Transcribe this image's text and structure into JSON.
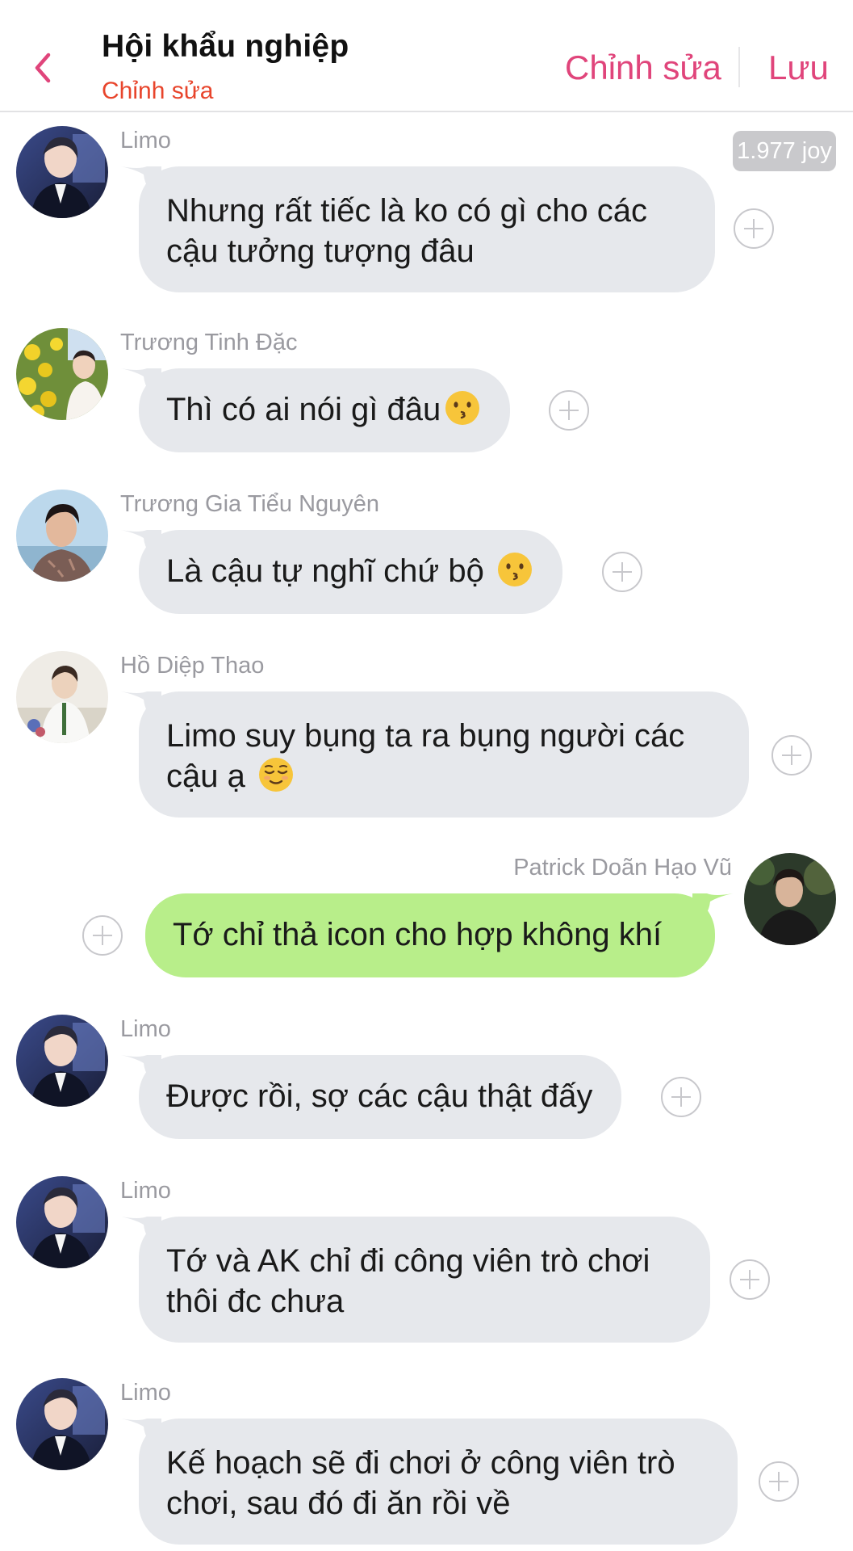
{
  "header": {
    "title": "Hội khẩu nghiệp",
    "subtitle": "Chỉnh sửa",
    "edit_label": "Chỉnh sửa",
    "save_label": "Lưu"
  },
  "joy_badge": "1.977 joy",
  "messages": [
    {
      "sender": "Limo",
      "text": "Nhưng rất tiếc là ko có gì cho các cậu tưởng tượng đâu",
      "direction": "incoming"
    },
    {
      "sender": "Trương Tinh Đặc",
      "text": "Thì có ai nói gì đâu",
      "emoji": "kissing-face",
      "direction": "incoming"
    },
    {
      "sender": "Trương Gia Tiểu Nguyên",
      "text": "Là cậu tự nghĩ chứ bộ ",
      "emoji": "kissing-face",
      "direction": "incoming"
    },
    {
      "sender": "Hồ Diệp Thao",
      "text": "Limo suy bụng ta ra bụng người các cậu ạ ",
      "emoji": "relieved-face",
      "direction": "incoming"
    },
    {
      "sender": "Patrick Doãn Hạo Vũ",
      "text": "Tớ chỉ thả icon cho hợp không khí",
      "direction": "outgoing"
    },
    {
      "sender": "Limo",
      "text": "Được rồi, sợ các cậu thật đấy",
      "direction": "incoming"
    },
    {
      "sender": "Limo",
      "text": "Tớ và AK chỉ đi công viên trò chơi thôi đc chưa",
      "direction": "incoming"
    },
    {
      "sender": "Limo",
      "text": "Kế hoạch sẽ đi chơi ở công viên trò chơi, sau đó đi ăn rồi về",
      "direction": "incoming"
    }
  ],
  "colors": {
    "accent": "#e0457b",
    "subtitle": "#e8452c",
    "incoming_bubble": "#e6e8ec",
    "outgoing_bubble": "#b8ee8a"
  }
}
